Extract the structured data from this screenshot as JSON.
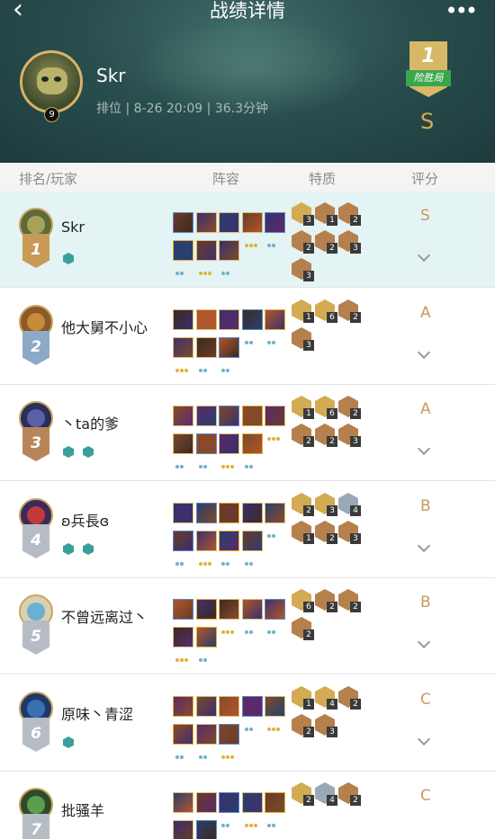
{
  "header": {
    "title": "战绩详情",
    "back_icon": "chevron-left-icon",
    "more_icon": "more-dots-icon",
    "player_name": "Skr",
    "player_level": "9",
    "meta": "排位 | 8-26 20:09 | 36.3分钟",
    "placement": "1",
    "placement_tag": "险胜局",
    "grade": "S"
  },
  "columns": [
    "排名/玩家",
    "阵容",
    "特质",
    "评分"
  ],
  "colors": {
    "header_bg": "#2a4f4f",
    "gold_text": "#d6aa55",
    "row_highlight": "#e4f3f4",
    "rank_gold": "#c99a55",
    "rank_silver": "#b5bcc4",
    "rank_bronze": "#b8855a",
    "rank_blue": "#8ea8c8",
    "grade_color": "#c89a5a"
  },
  "rows": [
    {
      "rank": "1",
      "name": "Skr",
      "level": "9",
      "grade": "S",
      "rank_color": "#c99a55",
      "badge_icons": [
        "hexagon-badge-icon"
      ],
      "champ_count": 8,
      "trait_counts": [
        "3",
        "1",
        "2",
        "2",
        "2",
        "3",
        "3"
      ],
      "trait_tiers": [
        "gold",
        "bronze",
        "bronze",
        "bronze",
        "bronze",
        "bronze",
        "bronze"
      ]
    },
    {
      "rank": "2",
      "name": "他大舅不小心",
      "grade": "A",
      "rank_color": "#8ea8c8",
      "badge_icons": [],
      "champ_count": 8,
      "trait_counts": [
        "1",
        "6",
        "2",
        "3"
      ],
      "trait_tiers": [
        "gold",
        "gold",
        "bronze",
        "bronze"
      ]
    },
    {
      "rank": "3",
      "name": "丶ta的爹",
      "grade": "A",
      "rank_color": "#b8855a",
      "badge_icons": [
        "helmet-badge-icon",
        "hexagon-badge-icon"
      ],
      "champ_count": 9,
      "trait_counts": [
        "1",
        "6",
        "2",
        "2",
        "2",
        "3"
      ],
      "trait_tiers": [
        "gold",
        "gold",
        "bronze",
        "bronze",
        "bronze",
        "bronze"
      ]
    },
    {
      "rank": "4",
      "name": "ʚ兵長ɞ",
      "grade": "B",
      "rank_color": "#b5bcc4",
      "badge_icons": [
        "helmet-badge-icon",
        "hexagon-badge-icon"
      ],
      "champ_count": 9,
      "trait_counts": [
        "2",
        "3",
        "4",
        "1",
        "2",
        "3"
      ],
      "trait_tiers": [
        "gold",
        "gold",
        "silver",
        "bronze",
        "bronze",
        "bronze"
      ]
    },
    {
      "rank": "5",
      "name": "不曾远离过丶",
      "grade": "B",
      "rank_color": "#b5bcc4",
      "badge_icons": [],
      "champ_count": 7,
      "trait_counts": [
        "6",
        "2",
        "2",
        "2"
      ],
      "trait_tiers": [
        "gold",
        "bronze",
        "bronze",
        "bronze"
      ]
    },
    {
      "rank": "6",
      "name": "原味丶青涩",
      "grade": "C",
      "rank_color": "#b5bcc4",
      "badge_icons": [
        "hexagon-badge-icon"
      ],
      "champ_count": 8,
      "trait_counts": [
        "1",
        "4",
        "2",
        "2",
        "3"
      ],
      "trait_tiers": [
        "gold",
        "gold",
        "bronze",
        "bronze",
        "bronze"
      ]
    },
    {
      "rank": "7",
      "name": "批骚羊",
      "grade": "C",
      "rank_color": "#b5bcc4",
      "badge_icons": [],
      "champ_count": 7,
      "trait_counts": [
        "2",
        "4",
        "2"
      ],
      "trait_tiers": [
        "gold",
        "silver",
        "bronze"
      ]
    }
  ]
}
